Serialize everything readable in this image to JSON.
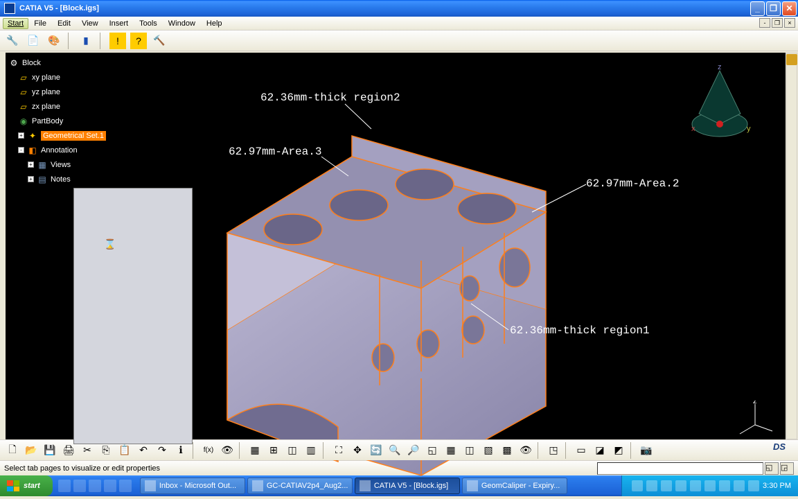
{
  "window": {
    "title": "CATIA V5 - [Block.igs]"
  },
  "menu": {
    "start": "Start",
    "file": "File",
    "edit": "Edit",
    "view": "View",
    "insert": "Insert",
    "tools": "Tools",
    "window": "Window",
    "help": "Help"
  },
  "tree": {
    "root": "Block",
    "items": [
      "xy plane",
      "yz plane",
      "zx plane",
      "PartBody",
      "Geometrical Set.1",
      "Annotation",
      "Views",
      "Notes"
    ]
  },
  "annotations": {
    "a1": "62.36mm-thick region2",
    "a2": "62.97mm-Area.3",
    "a3": "62.97mm-Area.2",
    "a4": "62.36mm-thick region1"
  },
  "compass": {
    "x": "x",
    "y": "y",
    "z": "z"
  },
  "status": {
    "message": "Select tab pages to visualize or edit properties"
  },
  "taskbar": {
    "start": "start",
    "tasks": [
      "Inbox - Microsoft Out...",
      "GC-CATIAV2p4_Aug2...",
      "CATIA V5 - [Block.igs]",
      "GeomCaliper - Expiry..."
    ],
    "clock": "3:30 PM"
  },
  "icons": {
    "workbench": "⚙",
    "warn": "⚠",
    "help": "?",
    "new": "🗋",
    "open": "📂",
    "save": "💾",
    "print": "🖨",
    "cut": "✂",
    "copy": "⎘",
    "paste": "📋",
    "undo": "↶",
    "redo": "↷",
    "info": "ℹ",
    "fx": "f(x)",
    "view": "👁",
    "fit": "⛶",
    "pan": "✥",
    "rotate": "🔄",
    "zoomin": "🔍+",
    "zoomout": "🔍-",
    "normal": "◱",
    "multi": "▦",
    "iso": "◫",
    "shade": "▧",
    "wire": "▩",
    "hide": "👁",
    "cam": "📷"
  }
}
